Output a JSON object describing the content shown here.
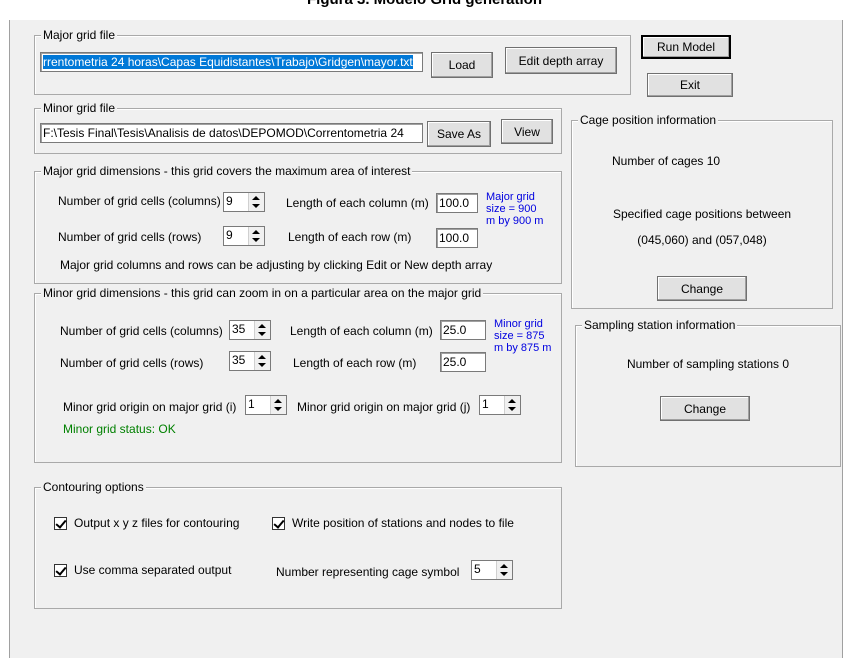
{
  "top_title": "Figura 3. Modelo Grid generation",
  "major_grid_file": {
    "legend": "Major grid file",
    "path": "rrentometria 24 horas\\Capas Equidistantes\\Trabajo\\Gridgen\\mayor.txt",
    "load_label": "Load",
    "edit_label": "Edit depth array"
  },
  "buttons": {
    "run_model": "Run Model",
    "exit": "Exit"
  },
  "minor_grid_file": {
    "legend": "Minor grid file",
    "path": "F:\\Tesis Final\\Tesis\\Analisis de datos\\DEPOMOD\\Correntometria 24",
    "save_as_label": "Save As",
    "view_label": "View"
  },
  "major_dims": {
    "legend": "Major grid dimensions - this grid covers the maximum area of interest",
    "cols_label": "Number of grid cells (columns)",
    "cols_value": "9",
    "rows_label": "Number of grid cells (rows)",
    "rows_value": "9",
    "col_len_label": "Length of each column (m)",
    "col_len_value": "100.0",
    "row_len_label": "Length of each row (m)",
    "row_len_value": "100.0",
    "size_note_1": "Major grid",
    "size_note_2": "size = 900",
    "size_note_3": "m by 900 m",
    "note": "Major grid columns and rows can be adjusting by clicking Edit or New depth array"
  },
  "minor_dims": {
    "legend": "Minor grid dimensions - this grid can zoom in on a particular area on the major grid",
    "cols_label": "Number of grid cells (columns)",
    "cols_value": "35",
    "rows_label": "Number of grid cells (rows)",
    "rows_value": "35",
    "col_len_label": "Length of each column (m)",
    "col_len_value": "25.0",
    "row_len_label": "Length of each row (m)",
    "row_len_value": "25.0",
    "size_note_1": "Minor grid",
    "size_note_2": "size = 875",
    "size_note_3": "m by 875 m",
    "origin_i_label": "Minor grid origin on major grid (i)",
    "origin_i_value": "1",
    "origin_j_label": "Minor grid origin on major grid (j)",
    "origin_j_value": "1",
    "status": "Minor grid status: OK"
  },
  "contouring": {
    "legend": "Contouring options",
    "opt_xyz": "Output x y z files for contouring",
    "opt_positions": "Write position of stations and nodes to file",
    "opt_comma": "Use comma separated output",
    "cage_symbol_label": "Number representing cage symbol",
    "cage_symbol_value": "5"
  },
  "cage_info": {
    "legend": "Cage position information",
    "count_label": "Number of cages  10",
    "positions_label": "Specified cage positions between",
    "positions_range": "(045,060) and (057,048)",
    "change_label": "Change"
  },
  "sampling_info": {
    "legend": "Sampling station information",
    "count_label": "Number of sampling stations  0",
    "change_label": "Change"
  },
  "colors": {
    "selection": "#0078d7",
    "note_blue": "#0000e0",
    "status_green": "#008000",
    "window_bg": "#f0f0f0"
  }
}
